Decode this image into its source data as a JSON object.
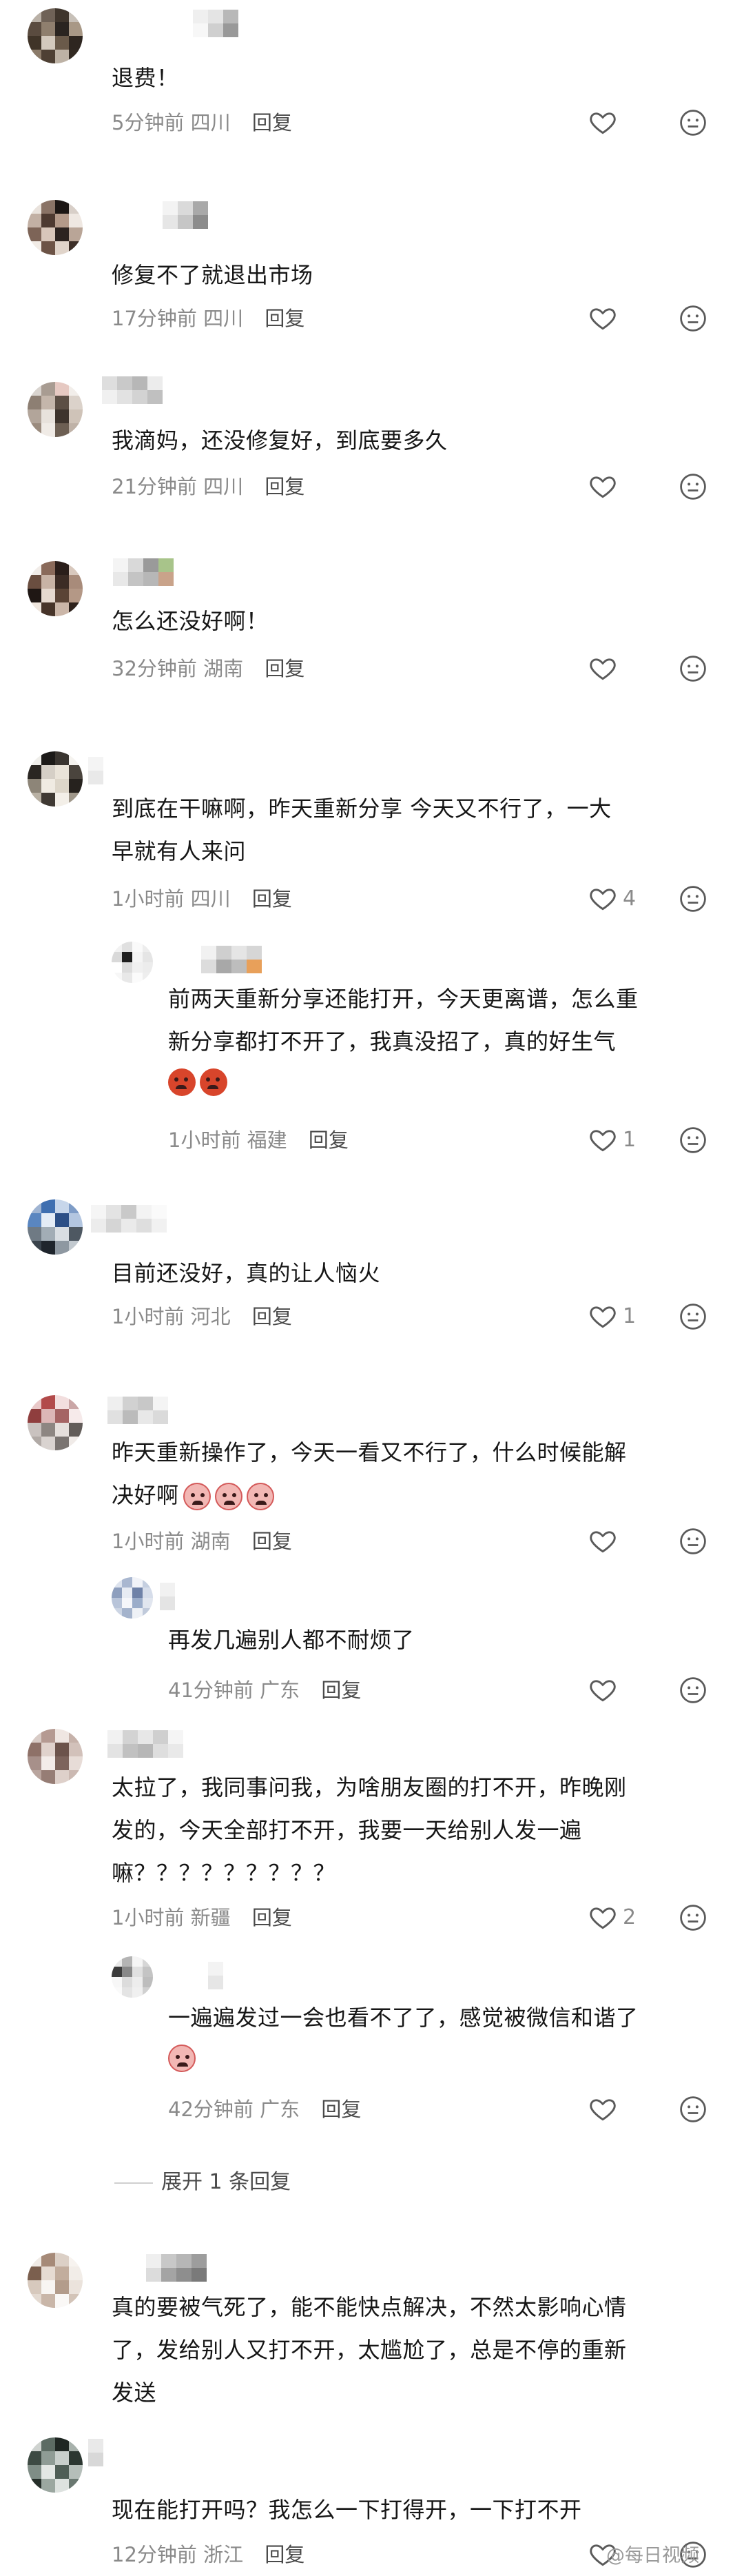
{
  "comments": [
    {
      "text": "退费！",
      "time": "5分钟前",
      "location": "四川",
      "reply": "回复",
      "likes": ""
    },
    {
      "text": "修复不了就退出市场",
      "time": "17分钟前",
      "location": "四川",
      "reply": "回复",
      "likes": ""
    },
    {
      "text": "我滴妈，还没修复好，到底要多久",
      "time": "21分钟前",
      "location": "四川",
      "reply": "回复",
      "likes": ""
    },
    {
      "text": "怎么还没好啊！",
      "time": "32分钟前",
      "location": "湖南",
      "reply": "回复",
      "likes": ""
    },
    {
      "text_lines": [
        "到底在干嘛啊，昨天重新分享  今天又不行了，一大",
        "早就有人来问"
      ],
      "time": "1小时前",
      "location": "四川",
      "reply": "回复",
      "likes": "4",
      "subreply": {
        "text_lines": [
          "前两天重新分享还能打开，今天更离谱，怎么重",
          "新分享都打不开了，我真没招了，真的好生气"
        ],
        "emojis": [
          "angry-face-emoji",
          "angry-face-emoji"
        ],
        "time": "1小时前",
        "location": "福建",
        "reply": "回复",
        "likes": "1"
      }
    },
    {
      "text": "目前还没好，真的让人恼火",
      "time": "1小时前",
      "location": "河北",
      "reply": "回复",
      "likes": "1"
    },
    {
      "text_lines": [
        "昨天重新操作了，今天一看又不行了，什么时候能解",
        "决好啊"
      ],
      "emojis": [
        "crying-face-emoji",
        "crying-face-emoji",
        "crying-face-emoji"
      ],
      "time": "1小时前",
      "location": "湖南",
      "reply": "回复",
      "likes": "",
      "subreply": {
        "text": "再发几遍别人都不耐烦了",
        "time": "41分钟前",
        "location": "广东",
        "reply": "回复",
        "likes": ""
      }
    },
    {
      "text_lines": [
        "太拉了，我同事问我，为啥朋友圈的打不开，昨晚刚",
        "发的，今天全部打不开，我要一天给别人发一遍",
        "嘛？？？？？？？？？"
      ],
      "time": "1小时前",
      "location": "新疆",
      "reply": "回复",
      "likes": "2",
      "subreply": {
        "text_lines": [
          "一遍遍发过一会也看不了了，感觉被微信和谐了"
        ],
        "emojis": [
          "crying-face-emoji"
        ],
        "time": "42分钟前",
        "location": "广东",
        "reply": "回复",
        "likes": ""
      },
      "expand": "展开 1 条回复"
    },
    {
      "text_lines": [
        "真的要被气死了，能不能快点解决，不然太影响心情",
        "了，发给别人又打不开，太尴尬了，总是不停的重新",
        "发送"
      ],
      "time": "",
      "location": "",
      "reply": "",
      "likes": ""
    },
    {
      "text": "现在能打开吗？我怎么一下打得开，一下打不开",
      "time": "12分钟前",
      "location": "浙江",
      "reply": "回复",
      "likes": ""
    }
  ],
  "watermark": "@每日视频",
  "icons": {
    "like": "heart-outline-icon",
    "react": "neutral-face-icon"
  },
  "colors": {
    "text": "#161616",
    "meta": "#8a8a8a",
    "icon": "#5a5a5a"
  }
}
